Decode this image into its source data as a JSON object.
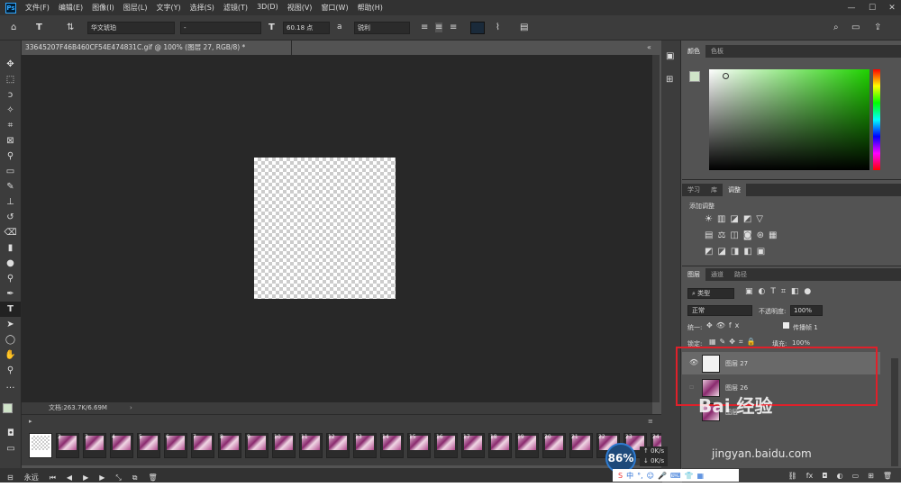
{
  "menu": [
    "文件(F)",
    "编辑(E)",
    "图像(I)",
    "图层(L)",
    "文字(Y)",
    "选择(S)",
    "滤镜(T)",
    "3D(D)",
    "视图(V)",
    "窗口(W)",
    "帮助(H)"
  ],
  "logo": "Ps",
  "options": {
    "font_family": "华文琥珀",
    "font_style": "-",
    "font_size": "60.18 点",
    "aa_label": "a",
    "antialias": "锐利"
  },
  "document": {
    "tab_title": "33645207F46B460CF54E474831C.gif @ 100% (图层 27, RGB/8) *",
    "status": "文档:263.7K/6.69M"
  },
  "color_panel": {
    "tabs": [
      "颜色",
      "色板"
    ]
  },
  "adjust_panel": {
    "tabs": [
      "学习",
      "库",
      "调整"
    ],
    "add_label": "添加调整"
  },
  "layers_panel": {
    "tabs": [
      "图层",
      "通道",
      "路径"
    ],
    "filter": "类型",
    "blend_mode": "正常",
    "opacity_label": "不透明度:",
    "opacity": "100%",
    "unify_label": "统一:",
    "propagate_label": "传播帧 1",
    "lock_label": "锁定:",
    "fill_label": "填充:",
    "fill": "100%",
    "layers": [
      {
        "name": "图层 27"
      },
      {
        "name": "图层 26"
      },
      {
        "name": "图层"
      }
    ]
  },
  "timeline": {
    "frames": [
      {
        "n": "2"
      },
      {
        "n": "3"
      },
      {
        "n": "4"
      },
      {
        "n": "5"
      },
      {
        "n": "6"
      },
      {
        "n": "7"
      },
      {
        "n": "8"
      },
      {
        "n": "9"
      },
      {
        "n": "10"
      },
      {
        "n": "11"
      },
      {
        "n": "12"
      },
      {
        "n": "13"
      },
      {
        "n": "14"
      },
      {
        "n": "15"
      },
      {
        "n": "16"
      },
      {
        "n": "17"
      },
      {
        "n": "18"
      },
      {
        "n": "19"
      },
      {
        "n": "20"
      },
      {
        "n": "21"
      },
      {
        "n": "22"
      },
      {
        "n": "23"
      },
      {
        "n": "24"
      }
    ],
    "loop": "永远"
  },
  "overlay": {
    "speed": "86%",
    "up": "0K/s",
    "down": "0K/s",
    "ime_label": "中",
    "watermark": "Bai 经验",
    "watermark_url": "jingyan.baidu.com"
  }
}
